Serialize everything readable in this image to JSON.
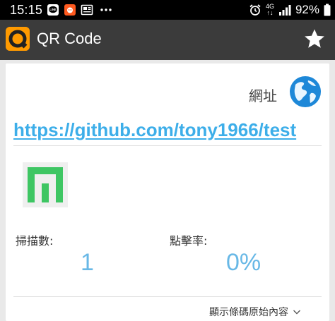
{
  "statusbar": {
    "time": "15:15",
    "network": "4G",
    "battery": "92%"
  },
  "appbar": {
    "title": "QR Code"
  },
  "result": {
    "type_label": "網址",
    "url": "https://github.com/tony1966/test"
  },
  "stats": {
    "scans_label": "掃描數:",
    "scans_value": "1",
    "clicks_label": "點擊率:",
    "clicks_value": "0%"
  },
  "footer": {
    "show_raw_label": "顯示條碼原始內容"
  },
  "colors": {
    "accent": "#3daee9",
    "stat_value": "#68b8e6",
    "appbar": "#3b3b3b",
    "qr_green": "#3ec663"
  }
}
